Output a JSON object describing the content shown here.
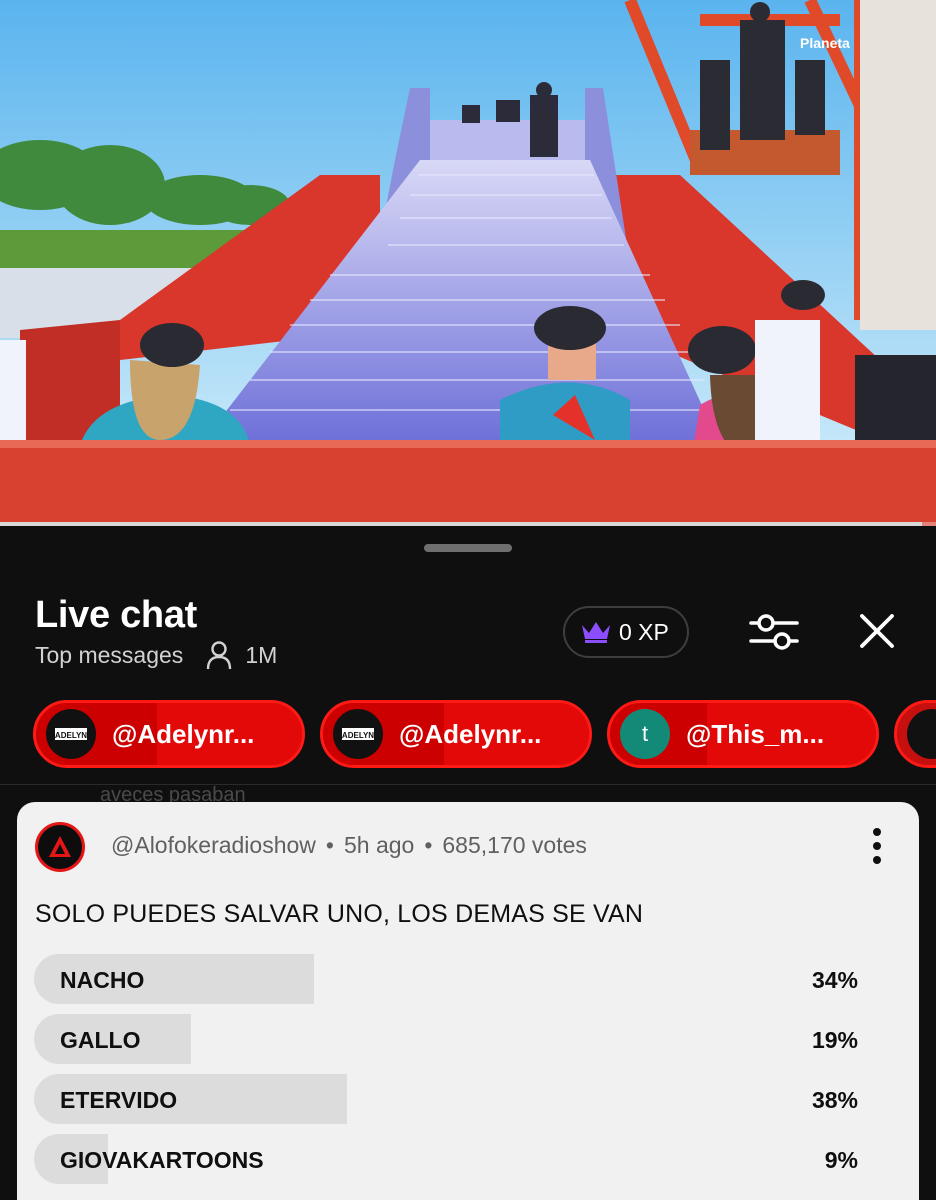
{
  "video": {
    "watermark": "Planeta",
    "progress": 0.985
  },
  "chat": {
    "title": "Live chat",
    "mode": "Top messages",
    "viewers": "1M",
    "xp": "0 XP"
  },
  "pinned": [
    {
      "handle": "@Adelynr...",
      "avatar": "logo",
      "avatar_text": "ADELYN"
    },
    {
      "handle": "@Adelynr...",
      "avatar": "logo",
      "avatar_text": "ADELYN"
    },
    {
      "handle": "@This_m...",
      "avatar": "letter",
      "avatar_text": "t"
    }
  ],
  "behind_text": "aveces pasaban",
  "poll": {
    "author": "@Alofokeradioshow",
    "time": "5h ago",
    "votes": "685,170 votes",
    "question": "SOLO PUEDES SALVAR UNO, LOS DEMAS SE VAN",
    "options": [
      {
        "label": "NACHO",
        "percent_text": "34%",
        "percent": 34
      },
      {
        "label": "GALLO",
        "percent_text": "19%",
        "percent": 19
      },
      {
        "label": "ETERVIDO",
        "percent_text": "38%",
        "percent": 38
      },
      {
        "label": "GIOVAKARTOONS",
        "percent_text": "9%",
        "percent": 9
      }
    ]
  },
  "colors": {
    "chip_red": "#e30909",
    "poll_bg": "#f1f1f1",
    "bar_fill": "#dcdcdc",
    "crown": "#8c4dff"
  }
}
